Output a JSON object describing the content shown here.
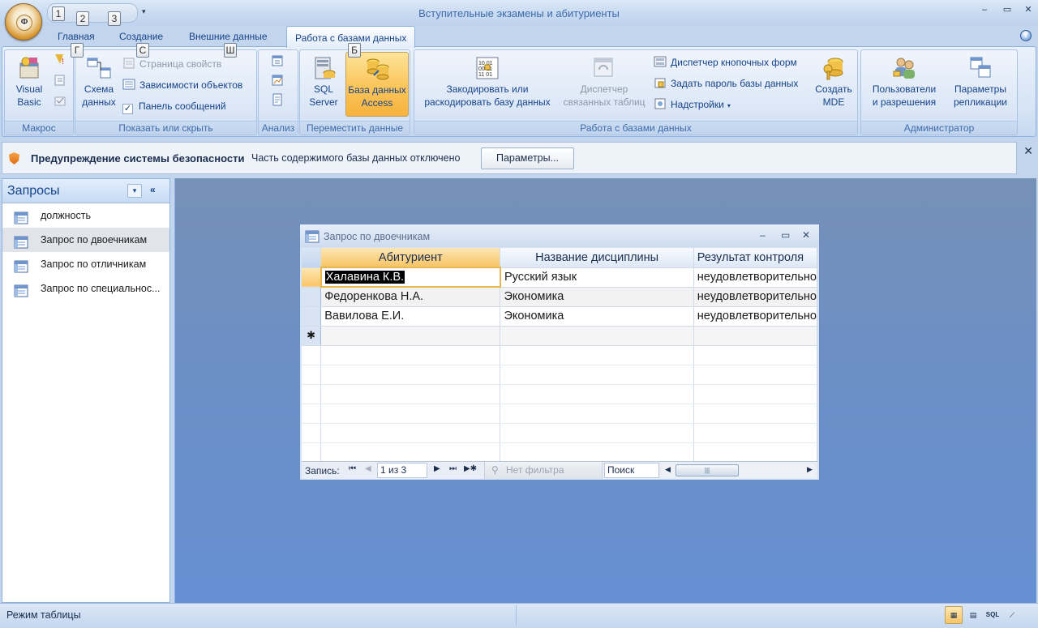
{
  "app": {
    "title": "Вступительные экзамены и абитуриенты",
    "office_button_glyph": "Ф",
    "window_controls": [
      "–",
      "▭",
      "✕"
    ]
  },
  "qat": {
    "keytips": [
      "1",
      "2",
      "3"
    ],
    "more": "▾"
  },
  "tabs": [
    {
      "label": "Главная"
    },
    {
      "label": "Создание"
    },
    {
      "label": "Внешние данные"
    },
    {
      "label": "Работа с базами данных",
      "active": true
    }
  ],
  "tab_keytips": {
    "home": "Г",
    "create": "С",
    "external": "Ш",
    "db": "Б"
  },
  "ribbon": {
    "macro": {
      "label": "Макрос",
      "visual_basic": "Visual\nBasic"
    },
    "show_hide": {
      "label": "Показать или скрыть",
      "schema": "Схема\nданных",
      "property_page": "Страница свойств",
      "object_dependencies": "Зависимости объектов",
      "message_bar": "Панель сообщений",
      "message_bar_checked": "✓"
    },
    "analysis": {
      "label": "Анализ"
    },
    "move_data": {
      "label": "Переместить данные",
      "sql_server": "SQL\nServer",
      "access_db": "База данных\nAccess"
    },
    "db_tools": {
      "label": "Работа с базами данных",
      "encode": "Закодировать или\nраскодировать базу данных",
      "linked_tables": "Диспетчер\nсвязанных таблиц",
      "switchboard": "Диспетчер кнопочных форм",
      "set_password": "Задать пароль базы данных",
      "addins": "Надстройки",
      "create_mde": "Создать\nMDE"
    },
    "admin": {
      "label": "Администратор",
      "users": "Пользователи\nи разрешения",
      "replication": "Параметры\nрепликации"
    }
  },
  "message_bar": {
    "title": "Предупреждение системы безопасности",
    "text": "Часть содержимого базы данных отключено",
    "button": "Параметры...",
    "close": "✕"
  },
  "nav": {
    "title": "Запросы",
    "dropdown": "▾",
    "collapse": "«",
    "items": [
      {
        "label": "должность"
      },
      {
        "label": "Запрос по двоечникам",
        "selected": true
      },
      {
        "label": "Запрос по отличникам"
      },
      {
        "label": "Запрос по специальнос..."
      }
    ]
  },
  "query_window": {
    "title": "Запрос по двоечникам",
    "controls": [
      "–",
      "▭",
      "✕"
    ],
    "columns": [
      "Абитуриент",
      "Название дисциплины",
      "Результат контроля"
    ],
    "rows": [
      [
        "Халавина К.В.",
        "Русский язык",
        "неудовлетворительно"
      ],
      [
        "Федоренкова Н.А.",
        "Экономика",
        "неудовлетворительно"
      ],
      [
        "Вавилова Е.И.",
        "Экономика",
        "неудовлетворительно"
      ]
    ],
    "new_row_marker": "✱",
    "record_nav": {
      "label": "Запись:",
      "position": "1 из 3",
      "filter": "Нет фильтра",
      "search": "Поиск",
      "first": "⏮",
      "prev": "◀",
      "next": "▶",
      "last": "⏭",
      "new": "▶✱"
    }
  },
  "status": {
    "text": "Режим таблицы",
    "views": [
      "▦",
      "▤",
      "SQL",
      "⟋"
    ]
  }
}
